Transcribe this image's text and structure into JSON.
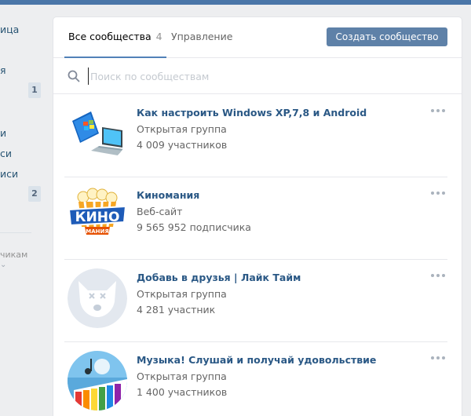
{
  "sidebar": {
    "items": [
      {
        "label": "ица"
      },
      {
        "label": "я"
      },
      {
        "label": "и"
      },
      {
        "label": "си"
      },
      {
        "label": "иси"
      }
    ],
    "badges": [
      "1",
      "2"
    ],
    "footer_label": "чикам"
  },
  "tabs": {
    "all_label": "Все сообщества",
    "all_count": "4",
    "manage_label": "Управление"
  },
  "create_button": "Создать сообщество",
  "search": {
    "placeholder": "Поиск по сообществам"
  },
  "communities": [
    {
      "name": "Как настроить Windows XP,7,8 и Android",
      "type": "Открытая группа",
      "members": "4 009 участников",
      "avatar": "windows-laptop-icon"
    },
    {
      "name": "Киномания",
      "type": "Веб-сайт",
      "members": "9 565 952 подписчика",
      "avatar": "kino-popcorn-logo"
    },
    {
      "name": "Добавь в друзья | Лайк Тайм",
      "type": "Открытая группа",
      "members": "4 281 участник",
      "avatar": "default-dog-avatar"
    },
    {
      "name": "Музыка! Слушай и получай удовольствие",
      "type": "Открытая группа",
      "members": "1 400 участников",
      "avatar": "music-piano-art"
    }
  ],
  "colors": {
    "link": "#2a5885",
    "button": "#5e81a8",
    "topbar": "#4a76a8",
    "background": "#edeef0"
  }
}
